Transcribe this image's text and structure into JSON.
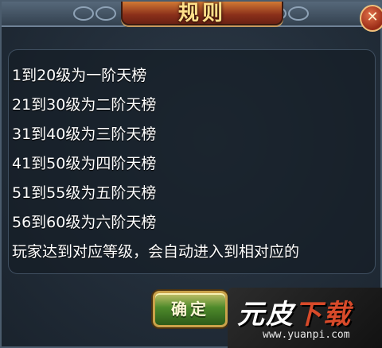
{
  "dialog": {
    "title": "规则",
    "close_label": "✕",
    "rules": [
      "1到20级为一阶天榜",
      "21到30级为二阶天榜",
      "31到40级为三阶天榜",
      "41到50级为四阶天榜",
      "51到55级为五阶天榜",
      "56到60级为六阶天榜",
      "玩家达到对应等级，会自动进入到相对应的"
    ],
    "confirm_label": "确定"
  },
  "watermark": {
    "text_main": "元皮",
    "text_accent": "下载",
    "url": "www.yuanpi.com"
  },
  "colors": {
    "title_text": "#ffe08a",
    "title_plate": "#8a2f1a",
    "confirm_button": "#4e8a2b",
    "panel_bg": "#222d39"
  }
}
